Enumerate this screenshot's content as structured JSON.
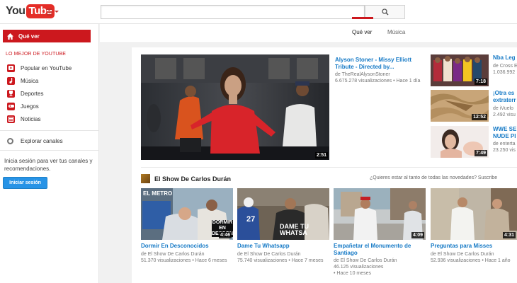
{
  "header": {
    "logo_you": "You",
    "logo_tube": "Tube",
    "search_placeholder": ""
  },
  "sidebar": {
    "what_to_watch": "Qué ver",
    "section_title": "LO MEJOR DE YOUTUBE",
    "items": [
      {
        "label": "Popular en YouTube",
        "icon": "popular-icon"
      },
      {
        "label": "Música",
        "icon": "music-icon"
      },
      {
        "label": "Deportes",
        "icon": "trophy-icon"
      },
      {
        "label": "Juegos",
        "icon": "gamepad-icon"
      },
      {
        "label": "Noticias",
        "icon": "news-icon"
      }
    ],
    "browse_channels": "Explorar canales",
    "signin_prompt": "Inicia sesión para ver tus canales y recomendaciones.",
    "signin_button": "Iniciar sesión"
  },
  "tabs": [
    {
      "label": "Qué ver",
      "active": true
    },
    {
      "label": "Música",
      "active": false
    }
  ],
  "featured": {
    "title": "Alyson Stoner - Missy Elliott Tribute - Directed by...",
    "channel": "de TheRealAlysonStoner",
    "meta": "6.675.278 visualizaciones • Hace 1 día",
    "duration": "2:51"
  },
  "side_videos": [
    {
      "title": "Nba Leg",
      "channel": "de Cross E",
      "meta": "1.036.992",
      "duration": "7:18"
    },
    {
      "title": "¡Otra es extraterr",
      "channel": "de iVuelo",
      "meta": "2.492 visu",
      "duration": "12:52"
    },
    {
      "title": "WWE SE NUDE PI",
      "channel": "de enterta",
      "meta": "23.250 vis",
      "duration": "7:49"
    }
  ],
  "shelf": {
    "title": "El Show De Carlos Durán",
    "subscribe_prompt": "¿Quieres estar al tanto de todas las novedades? Suscribe",
    "videos": [
      {
        "title": "Dormir En Desconocidos",
        "channel": "de El Show De Carlos Durán",
        "meta": "51.370 visualizaciones • Hace 6 meses",
        "duration": "4:46",
        "overlay": "EL METRO",
        "overlay2": "DORMIR EN DESCONO"
      },
      {
        "title": "Dame Tu Whatsapp",
        "channel": "de El Show De Carlos Durán",
        "meta": "75.740 visualizaciones • Hace 7 meses",
        "duration": "",
        "overlay": "DAME TU WHATSA"
      },
      {
        "title": "Empañetar el Monumento de Santiago",
        "channel": "de El Show De Carlos Durán",
        "meta": "46.125 visualizaciones",
        "meta2": "• Hace 10 meses",
        "duration": "4:09"
      },
      {
        "title": "Preguntas para Misses",
        "channel": "de El Show De Carlos Durán",
        "meta": "52.936 visualizaciones • Hace 1 año",
        "duration": "4:31"
      }
    ]
  }
}
